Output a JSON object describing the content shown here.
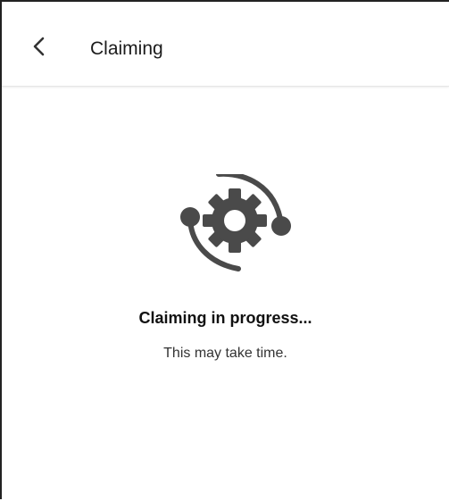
{
  "header": {
    "title": "Claiming",
    "back_icon": "chevron-left-icon"
  },
  "status": {
    "icon": "sync-gear-icon",
    "title": "Claiming in progress...",
    "subtitle": "This may take time."
  },
  "colors": {
    "icon": "#4a4a4a",
    "text_primary": "#111111",
    "text_secondary": "#333333",
    "divider": "#e6e6e6"
  }
}
